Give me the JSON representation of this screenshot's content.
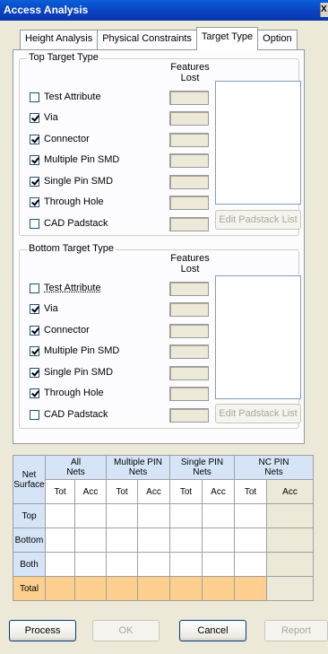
{
  "window": {
    "title": "Access Analysis",
    "close_glyph": "X"
  },
  "tabs": [
    "Height Analysis",
    "Physical Constraints",
    "Target Type",
    "Option"
  ],
  "active_tab": 2,
  "top_group": {
    "legend": "Top Target Type",
    "features_lost_label": "Features Lost",
    "features_lost_line1": "Features",
    "features_lost_line2": "Lost",
    "items": [
      {
        "label": "Test Attribute",
        "checked": false
      },
      {
        "label": "Via",
        "checked": true
      },
      {
        "label": "Connector",
        "checked": true
      },
      {
        "label": "Multiple Pin SMD",
        "checked": true
      },
      {
        "label": "Single Pin SMD",
        "checked": true
      },
      {
        "label": "Through Hole",
        "checked": true
      },
      {
        "label": "CAD Padstack",
        "checked": false
      }
    ],
    "edit_button": "Edit Padstack List"
  },
  "bottom_group": {
    "legend": "Bottom Target Type",
    "features_lost_line1": "Features",
    "features_lost_line2": "Lost",
    "items": [
      {
        "label": "Test Attribute",
        "checked": false
      },
      {
        "label": "Via",
        "checked": true
      },
      {
        "label": "Connector",
        "checked": true
      },
      {
        "label": "Multiple Pin SMD",
        "checked": true
      },
      {
        "label": "Single Pin SMD",
        "checked": true
      },
      {
        "label": "Through Hole",
        "checked": true
      },
      {
        "label": "CAD Padstack",
        "checked": false
      }
    ],
    "edit_button": "Edit Padstack List"
  },
  "grid": {
    "corner_line1": "Net",
    "corner_line2": "Surface",
    "groups": [
      {
        "line1": "All",
        "line2": "Nets"
      },
      {
        "line1": "Multiple PIN",
        "line2": "Nets"
      },
      {
        "line1": "Single PIN",
        "line2": "Nets"
      },
      {
        "line1": "NC PIN",
        "line2": "Nets"
      }
    ],
    "tot": "Tot",
    "acc": "Acc",
    "rows": [
      "Top",
      "Bottom",
      "Both",
      "Total"
    ]
  },
  "buttons": {
    "process": "Process",
    "ok": "OK",
    "cancel": "Cancel",
    "report": "Report"
  },
  "colors": {
    "header_bg": "#d5e5f7",
    "total_bg": "#fdd08f",
    "title_bar": "#0a3fc0"
  }
}
